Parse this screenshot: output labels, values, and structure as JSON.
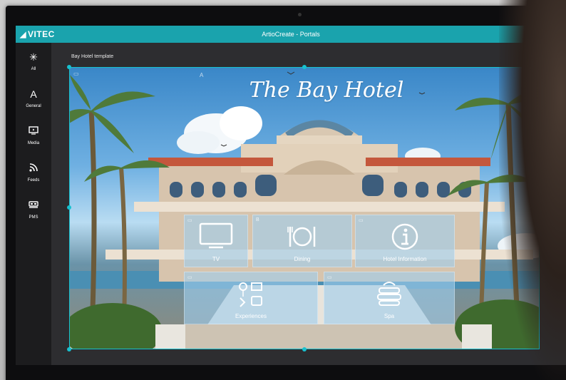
{
  "app": {
    "logo": "VITEC",
    "title": "ArtioCreate - Portals"
  },
  "sidebar": {
    "items": [
      {
        "label": "All",
        "icon": "asterisk-icon",
        "glyph": "✳"
      },
      {
        "label": "General",
        "icon": "text-icon",
        "glyph": "A"
      },
      {
        "label": "Media",
        "icon": "media-icon",
        "glyph": "▣"
      },
      {
        "label": "Feeds",
        "icon": "rss-icon",
        "glyph": "∿"
      },
      {
        "label": "PMS",
        "icon": "bed-icon",
        "glyph": "▭"
      }
    ]
  },
  "template": {
    "name": "Bay Hotel template"
  },
  "canvas": {
    "hotel_title": "The Bay Hotel",
    "tiles": [
      {
        "label": "TV",
        "icon": "tv-icon"
      },
      {
        "label": "Dining",
        "icon": "dining-icon"
      },
      {
        "label": "Hotel Information",
        "icon": "info-icon"
      },
      {
        "label": "Experiences",
        "icon": "experiences-icon"
      },
      {
        "label": "Spa",
        "icon": "spa-icon"
      }
    ]
  },
  "colors": {
    "accent": "#1aa3ad",
    "selection": "#17c1cf",
    "sidebar": "#1c1c1e",
    "workspace": "#2d2d30"
  }
}
